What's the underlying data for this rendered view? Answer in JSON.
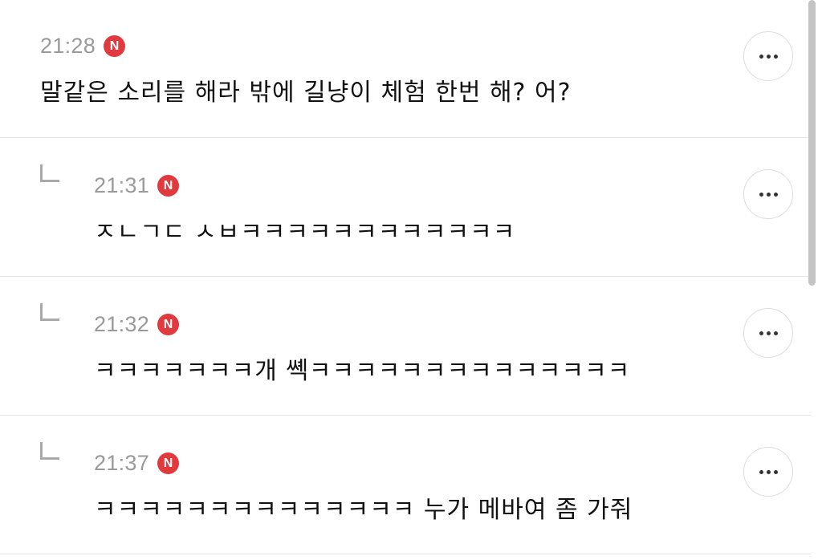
{
  "comments": [
    {
      "time": "21:28",
      "badge": "N",
      "text": "말같은 소리를 해라 밖에 길냥이 체험 한번 해? 어?",
      "is_reply": false
    },
    {
      "time": "21:31",
      "badge": "N",
      "text": "ㅈㄴㄱㄷ ㅅㅂㅋㅋㅋㅋㅋㅋㅋㅋㅋㅋㅋㅋ",
      "is_reply": true
    },
    {
      "time": "21:32",
      "badge": "N",
      "text": "ㅋㅋㅋㅋㅋㅋㅋ개 쎽ㅋㅋㅋㅋㅋㅋㅋㅋㅋㅋㅋㅋㅋㅋ",
      "is_reply": true
    },
    {
      "time": "21:37",
      "badge": "N",
      "text": "ㅋㅋㅋㅋㅋㅋㅋㅋㅋㅋㅋㅋㅋㅋ 누가 메바여 좀 가줘",
      "is_reply": true
    }
  ],
  "icons": {
    "more": "more-horizontal-icon",
    "reply": "reply-arrow-icon",
    "badge": "new-badge-icon"
  },
  "colors": {
    "badge": "#e0393e",
    "time": "#9a9a9a",
    "divider": "#e4e4e4",
    "text": "#111111"
  }
}
